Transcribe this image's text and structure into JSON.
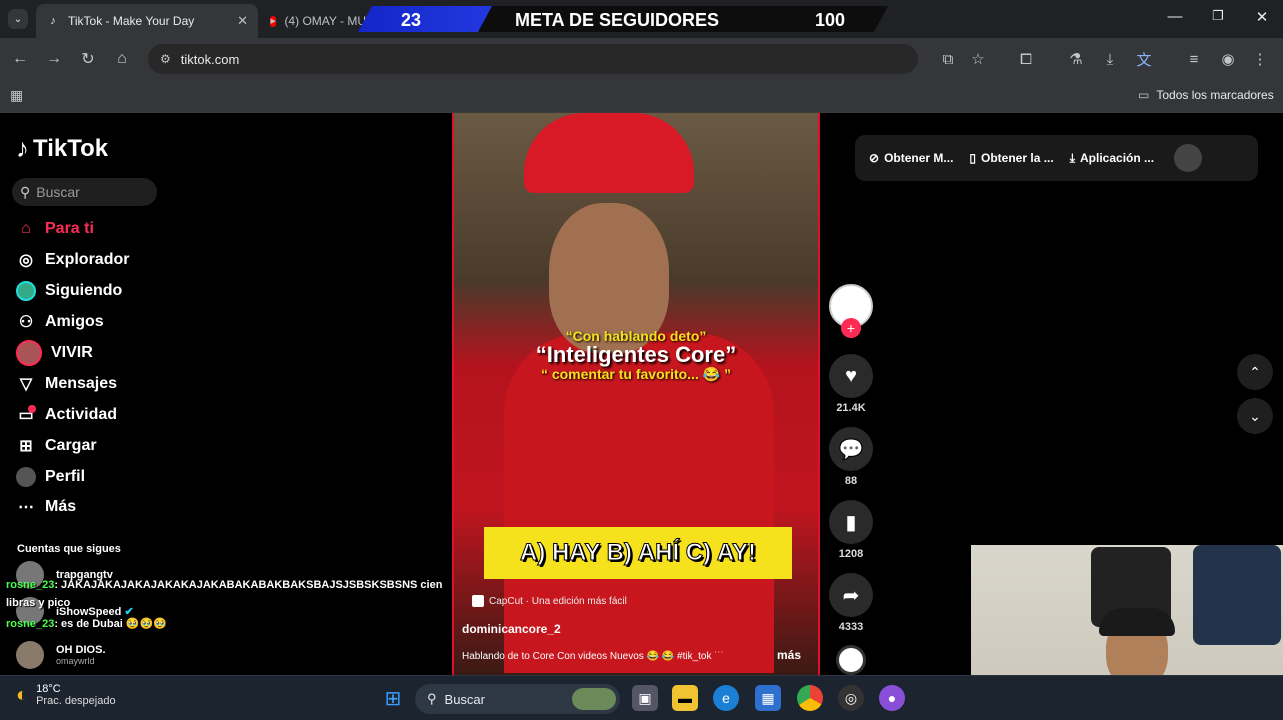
{
  "browser": {
    "active_tab": {
      "title": "TikTok - Make Your Day",
      "favicon": "tiktok-icon"
    },
    "inactive_tab": {
      "title": "(4) OMAY - MUS",
      "favicon": "youtube-icon"
    },
    "url": "tiktok.com",
    "bookmarks_folder": "Todos los marcadores"
  },
  "overlay": {
    "current_count": "23",
    "title": "META DE SEGUIDORES",
    "goal": "100"
  },
  "sidebar": {
    "logo": "TikTok",
    "search_placeholder": "Buscar",
    "items": [
      {
        "label": "Para ti",
        "icon": "home-icon",
        "active": true
      },
      {
        "label": "Explorador",
        "icon": "compass-icon"
      },
      {
        "label": "Siguiendo",
        "icon": "following-avatar-icon"
      },
      {
        "label": "Amigos",
        "icon": "friends-icon"
      },
      {
        "label": "VIVIR",
        "icon": "live-avatar-icon"
      },
      {
        "label": "Mensajes",
        "icon": "send-icon"
      },
      {
        "label": "Actividad",
        "icon": "activity-icon"
      },
      {
        "label": "Cargar",
        "icon": "upload-icon"
      },
      {
        "label": "Perfil",
        "icon": "profile-avatar-icon"
      },
      {
        "label": "Más",
        "icon": "more-icon"
      }
    ],
    "following_title": "Cuentas que sigues",
    "accounts": [
      {
        "name": "trapgangtv",
        "sub": ""
      },
      {
        "name": "iShowSpeed",
        "sub": ""
      },
      {
        "name": "OH DIOS.",
        "sub": "omaywrld"
      }
    ]
  },
  "chat": [
    {
      "user": "rosne_23",
      "text": ": JAKAJAKAJAKAJAKAKAJAKABAKABAKBAKSBAJSJSBSKSBSNS cien"
    },
    {
      "user": "",
      "text": "libras y pico"
    },
    {
      "user": "rosne_23",
      "text": ": es de Dubai 🥹🥹🥹"
    }
  ],
  "video": {
    "caption_top": "“Con hablando deto”",
    "caption_main": "“Inteligentes Core”",
    "caption_sub": "“ comentar tu favorito... 😂 ”",
    "quiz": "A) HAY B) AHÍ C) AY!",
    "capcut": "CapCut · Una edición más fácil",
    "author": "dominicancore_2",
    "description": "Hablando de to Core Con videos Nuevos 😂 😂 #tik_tok ˙˙˙",
    "more": "más"
  },
  "actions": {
    "likes": "21.4K",
    "comments": "88",
    "saves": "1208",
    "shares": "4333"
  },
  "appbar": {
    "item1": "Obtener M...",
    "item2": "Obtener la ...",
    "item3": "Aplicación ..."
  },
  "taskbar": {
    "weather_temp": "18°C",
    "weather_desc": "Prac. despejado",
    "search_placeholder": "Buscar"
  }
}
